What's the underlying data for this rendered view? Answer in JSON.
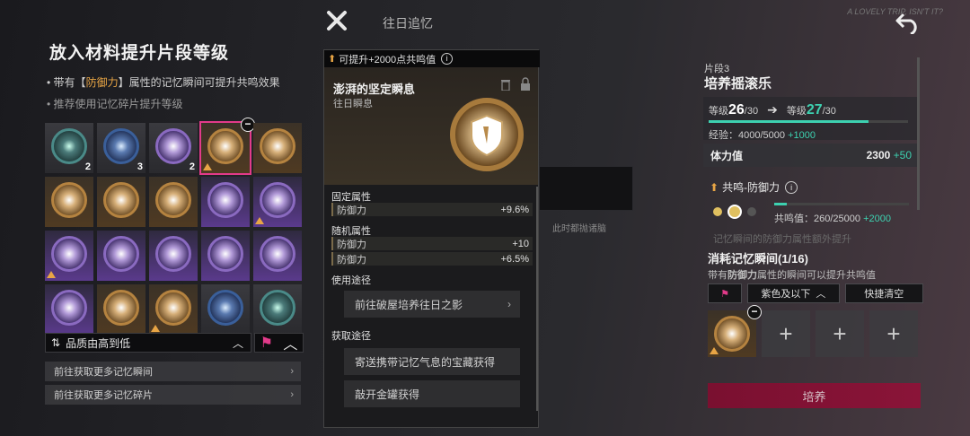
{
  "topbar": {
    "title": "往日追忆",
    "bg_scribble": "A LOVELY TRIP, ISN'T IT?"
  },
  "left": {
    "title": "放入材料提升片段等级",
    "bullet1_prefix": "带有【",
    "bullet1_hl": "防御力",
    "bullet1_suffix": "】属性的记忆瞬间可提升共鸣效果",
    "bullet2": "推荐使用记忆碎片提升等级",
    "grid": [
      {
        "style": "teal",
        "bg": "",
        "count": "2",
        "arrow": false
      },
      {
        "style": "blue",
        "bg": "",
        "count": "3",
        "arrow": false
      },
      {
        "style": "purple",
        "bg": "",
        "count": "2",
        "arrow": false
      },
      {
        "style": "gold",
        "bg": "gold",
        "count": "",
        "arrow": true,
        "selected": true
      },
      {
        "style": "gold",
        "bg": "gold",
        "count": "",
        "arrow": false
      },
      {
        "style": "gold",
        "bg": "gold",
        "count": "",
        "arrow": false
      },
      {
        "style": "gold",
        "bg": "gold",
        "count": "",
        "arrow": false
      },
      {
        "style": "gold",
        "bg": "gold",
        "count": "",
        "arrow": false
      },
      {
        "style": "purple",
        "bg": "purple",
        "count": "",
        "arrow": false
      },
      {
        "style": "purple",
        "bg": "purple",
        "count": "",
        "arrow": true
      },
      {
        "style": "purple",
        "bg": "purple",
        "count": "",
        "arrow": true
      },
      {
        "style": "purple",
        "bg": "purple",
        "count": "",
        "arrow": false
      },
      {
        "style": "purple",
        "bg": "purple",
        "count": "",
        "arrow": false
      },
      {
        "style": "purple",
        "bg": "purple",
        "count": "",
        "arrow": false
      },
      {
        "style": "purple",
        "bg": "purple",
        "count": "",
        "arrow": false
      },
      {
        "style": "purple",
        "bg": "purple",
        "count": "",
        "arrow": false
      },
      {
        "style": "gold",
        "bg": "gold",
        "count": "",
        "arrow": false
      },
      {
        "style": "gold",
        "bg": "gold",
        "count": "",
        "arrow": true
      },
      {
        "style": "blue",
        "bg": "",
        "count": "",
        "arrow": false
      },
      {
        "style": "teal",
        "bg": "",
        "count": "",
        "arrow": false
      }
    ],
    "sort_label": "品质由高到低",
    "link1": "前往获取更多记忆瞬间",
    "link2": "前往获取更多记忆碎片"
  },
  "popup": {
    "head": "可提升+2000点共鸣值",
    "item_name": "澎湃的坚定瞬息",
    "item_type": "往日瞬息",
    "fixed_title": "固定属性",
    "fixed_stat": {
      "name": "防御力",
      "value": "+9.6%"
    },
    "random_title": "随机属性",
    "random_stats": [
      {
        "name": "防御力",
        "value": "+10"
      },
      {
        "name": "防御力",
        "value": "+6.5%"
      }
    ],
    "use_title": "使用途径",
    "use_btn": "前往破屋培养往日之影",
    "get_title": "获取途径",
    "get_btn1": "寄送携带记忆气息的宝藏获得",
    "get_btn2": "敲开金罐获得"
  },
  "bg": {
    "mid_text": "此时都抛诸脑"
  },
  "right": {
    "seg_label": "片段3",
    "seg_name": "培养摇滚乐",
    "level_label": "等级",
    "level_from": "26",
    "level_max": "/30",
    "level_to": "27",
    "xp_label": "经验：",
    "xp_value": "4000/5000",
    "xp_plus": "+1000",
    "xp_progress": 0.8,
    "hp_label": "体力值",
    "hp_value": "2300",
    "hp_plus": "+50",
    "res_title": "共鸣-防御力",
    "res_label": "共鸣值：",
    "res_value": "260/25000",
    "res_plus": "+2000",
    "res_progress": 0.09,
    "res_note": "记忆瞬间的防御力属性额外提升",
    "consume_title": "消耗记忆瞬间(1/16)",
    "consume_desc_prefix": "带有",
    "consume_desc_hl": "防御力",
    "consume_desc_suffix": "属性的瞬间可以提升共鸣值",
    "filter_quality": "紫色及以下",
    "quick_clear": "快捷清空",
    "cultivate": "培养"
  },
  "colors": {
    "accent_pink": "#e23a8a",
    "teal": "#3dd1b0",
    "gold": "#e8a545",
    "button_red": "#8a1438"
  }
}
